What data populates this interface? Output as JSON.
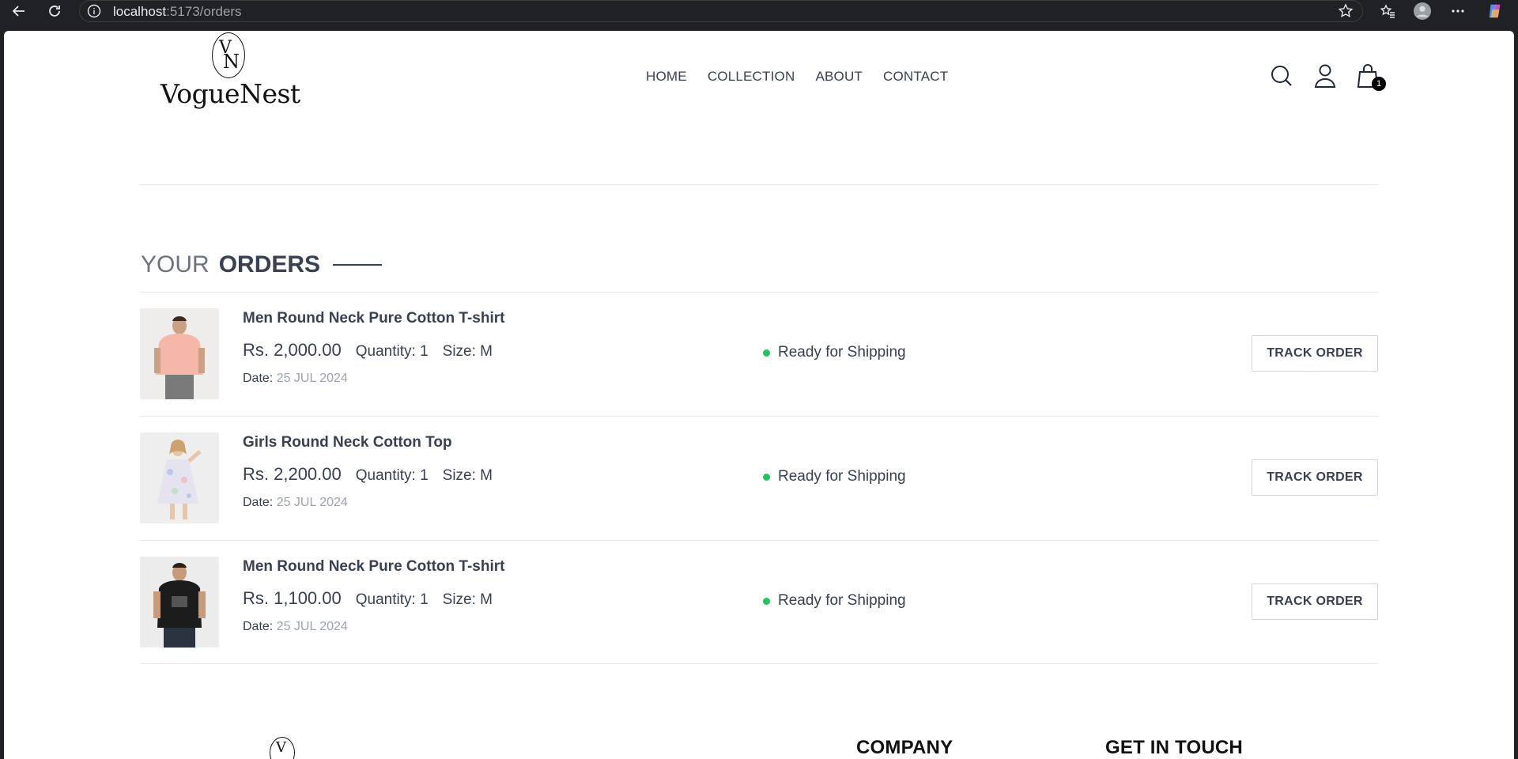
{
  "browser": {
    "url_host": "localhost",
    "url_path": ":5173/orders"
  },
  "header": {
    "logo_text": "VogueNest",
    "logo_monogram_top": "V",
    "logo_monogram_bottom": "N",
    "nav": [
      "HOME",
      "COLLECTION",
      "ABOUT",
      "CONTACT"
    ],
    "cart_count": "1"
  },
  "page": {
    "title_part1": "YOUR",
    "title_part2": "ORDERS"
  },
  "orders": [
    {
      "name": "Men Round Neck Pure Cotton T-shirt",
      "price": "Rs. 2,000.00",
      "quantity": "Quantity: 1",
      "size": "Size: M",
      "date_label": "Date: ",
      "date_value": "25 JUL 2024",
      "status": "Ready for Shipping",
      "action": "TRACK ORDER",
      "image": "man-pink-shirt"
    },
    {
      "name": "Girls Round Neck Cotton Top",
      "price": "Rs. 2,200.00",
      "quantity": "Quantity: 1",
      "size": "Size: M",
      "date_label": "Date: ",
      "date_value": "25 JUL 2024",
      "status": "Ready for Shipping",
      "action": "TRACK ORDER",
      "image": "girl-floral-dress"
    },
    {
      "name": "Men Round Neck Pure Cotton T-shirt",
      "price": "Rs. 1,100.00",
      "quantity": "Quantity: 1",
      "size": "Size: M",
      "date_label": "Date: ",
      "date_value": "25 JUL 2024",
      "status": "Ready for Shipping",
      "action": "TRACK ORDER",
      "image": "man-black-tshirt"
    }
  ],
  "footer": {
    "company_heading": "COMPANY",
    "contact_heading": "GET IN TOUCH"
  },
  "colors": {
    "status_dot": "#22c55e",
    "text": "#374151",
    "muted": "#9ca3af"
  }
}
